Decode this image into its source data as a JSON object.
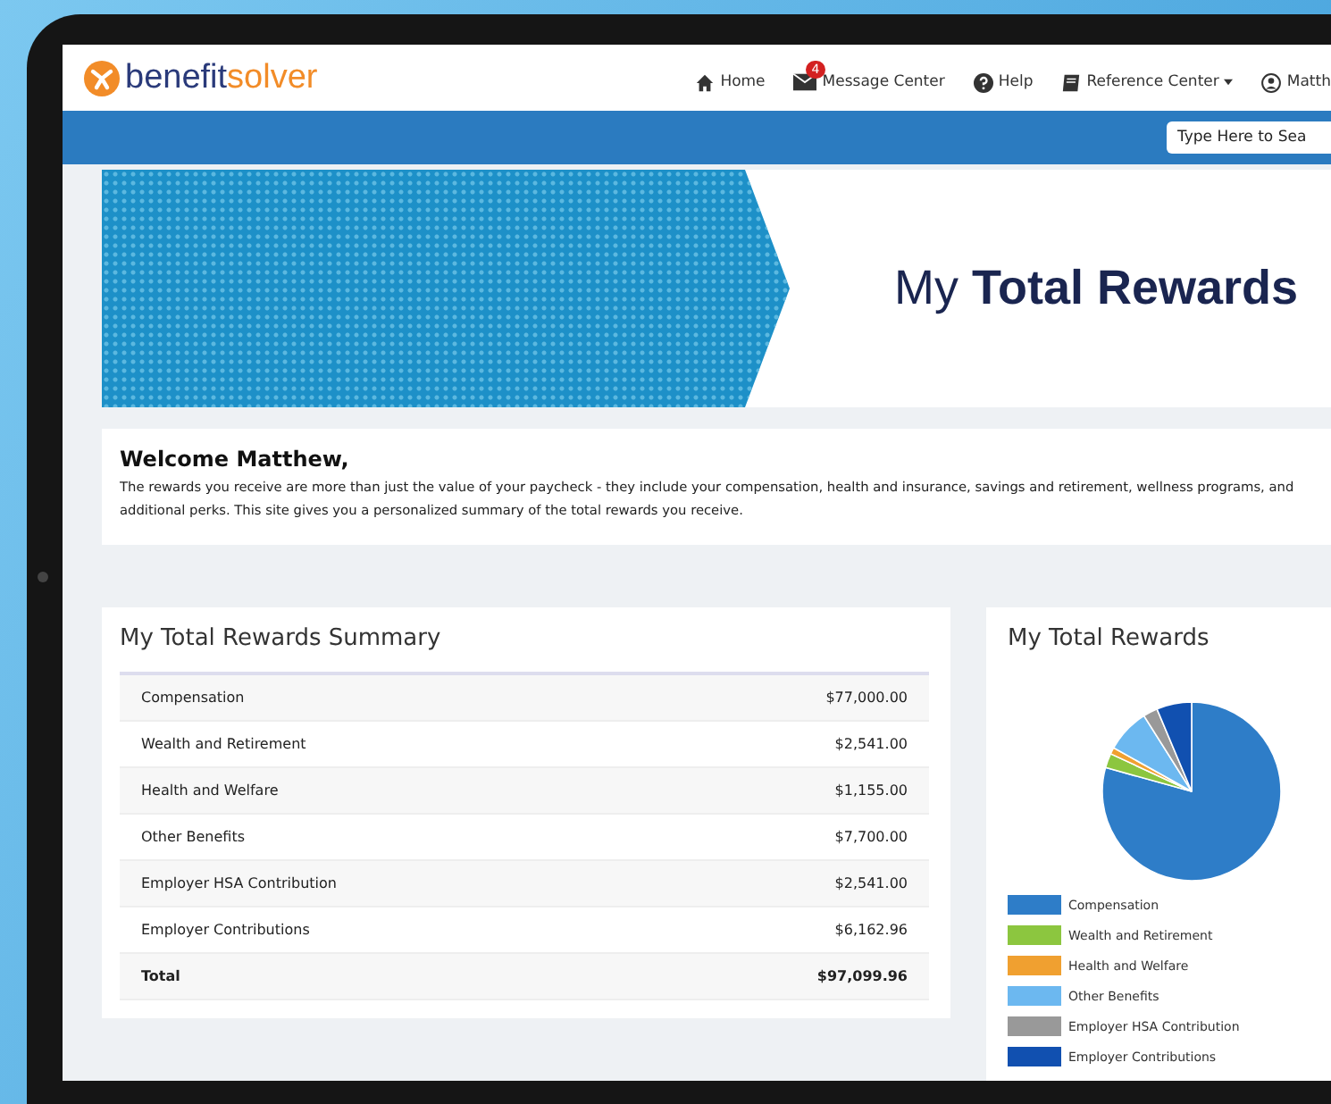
{
  "header": {
    "logo": {
      "prefix": "benefit",
      "suffix": "solver"
    },
    "nav": [
      {
        "kind": "home",
        "label": "Home"
      },
      {
        "kind": "messages",
        "label": "Message Center",
        "badge": "4"
      },
      {
        "kind": "help",
        "label": "Help"
      },
      {
        "kind": "reference",
        "label": "Reference Center"
      },
      {
        "kind": "user",
        "label": "Matth"
      }
    ]
  },
  "search": {
    "placeholder": "Type Here to Sea"
  },
  "banner": {
    "title": "My **Total Rewards**"
  },
  "welcome": {
    "heading": "Welcome Matthew,",
    "text": "The rewards you receive are more than just the value of your paycheck - they include your compensation, health and insurance, savings and retirement, wellness programs, and additional perks. This site gives you a personalized summary of the total rewards you receive."
  },
  "summary": {
    "title": "My Total Rewards Summary",
    "rows": [
      {
        "label": "Compensation",
        "amount": "$77,000.00"
      },
      {
        "label": "Wealth and Retirement",
        "amount": "$2,541.00"
      },
      {
        "label": "Health and Welfare",
        "amount": "$1,155.00"
      },
      {
        "label": "Other Benefits",
        "amount": "$7,700.00"
      },
      {
        "label": "Employer HSA Contribution",
        "amount": "$2,541.00"
      },
      {
        "label": "Employer Contributions",
        "amount": "$6,162.96"
      }
    ],
    "total": {
      "label": "Total",
      "amount": "$97,099.96"
    }
  },
  "rewards_chart": {
    "title": "My Total Rewards",
    "chart_data": {
      "type": "pie",
      "categories": [
        "Compensation",
        "Wealth and Retirement",
        "Health and Welfare",
        "Other Benefits",
        "Employer HSA Contribution",
        "Employer Contributions"
      ],
      "values": [
        79.3,
        2.62,
        1.19,
        7.93,
        2.62,
        6.34
      ],
      "legend": "bottom",
      "colors": [
        "#2e7dc8",
        "#8cc63f",
        "#f0a030",
        "#6cb8f0",
        "#999999",
        "#1150b0"
      ]
    }
  }
}
